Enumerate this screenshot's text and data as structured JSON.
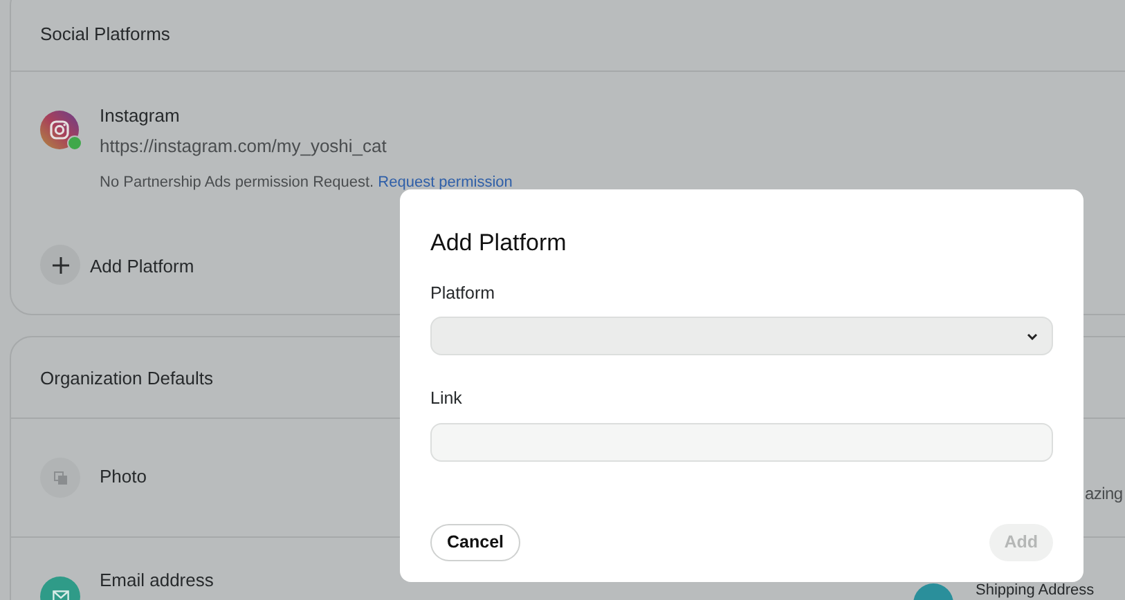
{
  "social_platforms": {
    "title": "Social Platforms",
    "platforms": [
      {
        "name": "Instagram",
        "link": "https://instagram.com/my_yoshi_cat",
        "connected": true,
        "note": "No Partnership Ads permission Request.",
        "note_link": "Request permission"
      }
    ],
    "add_label": "Add Platform"
  },
  "organization_defaults": {
    "title": "Organization Defaults",
    "rows": [
      {
        "kind": "photo",
        "label": "Photo"
      },
      {
        "kind": "email",
        "label": "Email address"
      }
    ],
    "right_rows": [
      {
        "kind": "text",
        "label": "azing"
      },
      {
        "kind": "shipping",
        "label": "Shipping Address"
      }
    ]
  },
  "dialog": {
    "title": "Add Platform",
    "fields": [
      {
        "kind": "select",
        "label": "Platform"
      },
      {
        "kind": "input",
        "label": "Link"
      }
    ],
    "buttons": [
      {
        "label": "Cancel",
        "disabled": false
      },
      {
        "label": "Add",
        "disabled": true
      }
    ]
  }
}
